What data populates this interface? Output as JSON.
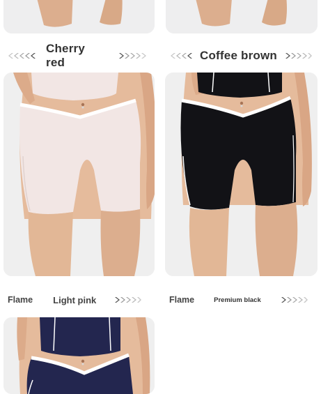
{
  "row1": {
    "left_label": "Cherry red",
    "right_label": "Coffee brown"
  },
  "row2": {
    "left_prefix": "Flame",
    "left_label": "Light pink",
    "right_prefix": "Flame",
    "right_label": "Premium black"
  },
  "colors": {
    "card_bg": "#eeeeef",
    "skin": "#e2b796",
    "light_pink": "#f2e6e4",
    "black": "#121216",
    "navy": "#23264f",
    "trim_white": "#ffffff",
    "arrow_gray": "#9a9a9a"
  },
  "icons": {
    "left_arrows": "double-chevron-left-icon",
    "right_arrows": "double-chevron-right-icon"
  }
}
